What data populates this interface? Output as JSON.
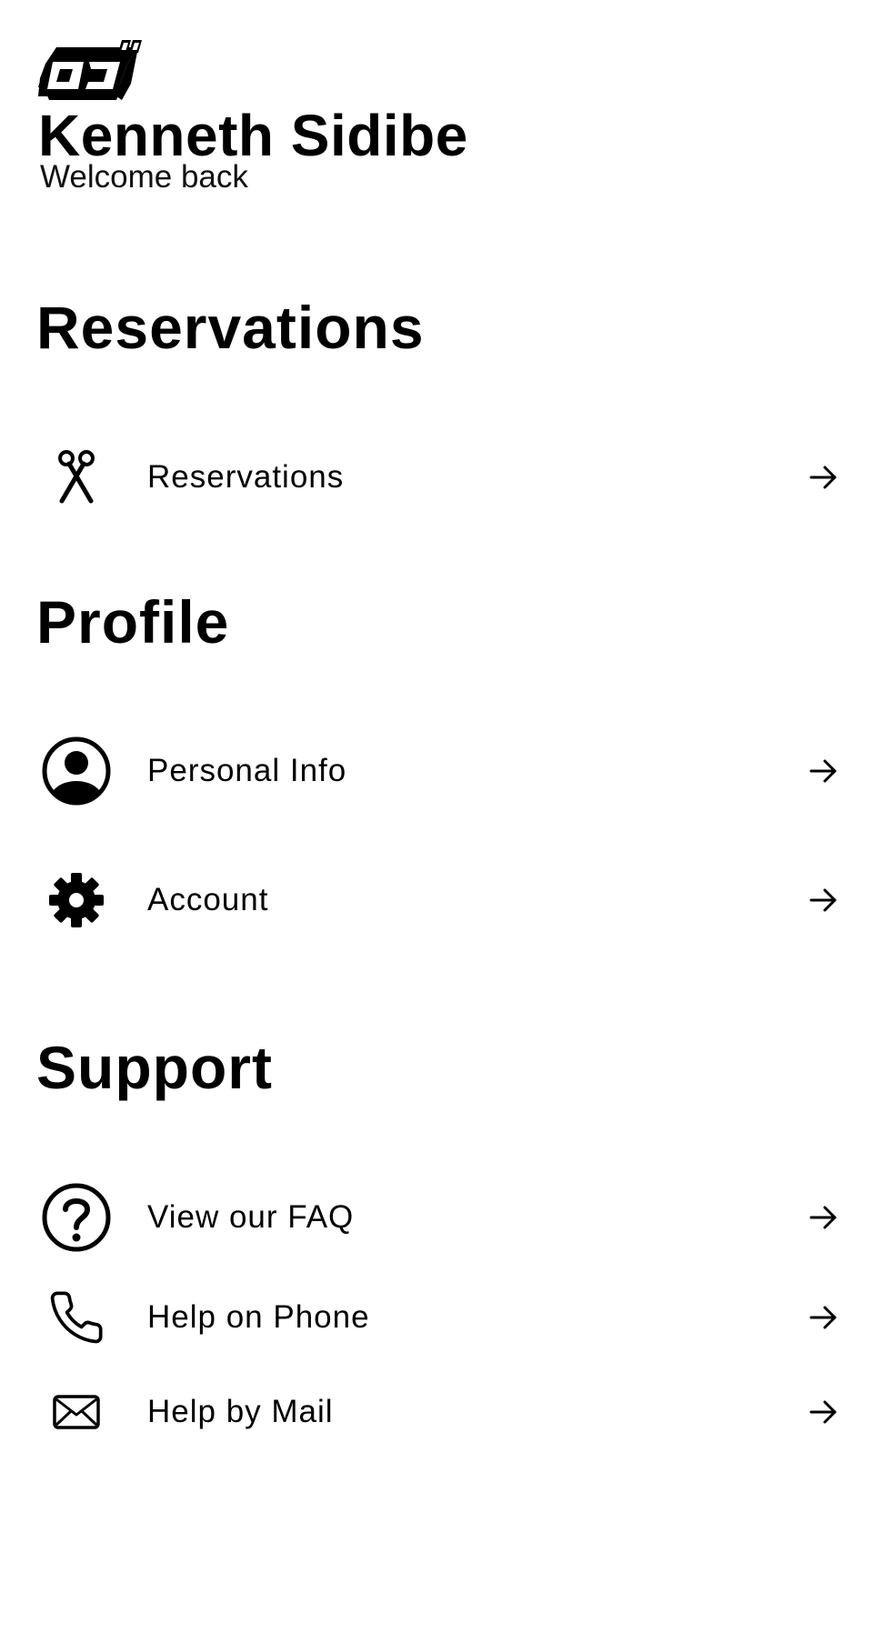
{
  "header": {
    "logo_text": "OJ",
    "user_name": "Kenneth Sidibe",
    "welcome_text": "Welcome back"
  },
  "sections": [
    {
      "title": "Reservations",
      "items": [
        {
          "label": "Reservations",
          "icon": "scissors-icon"
        }
      ]
    },
    {
      "title": "Profile",
      "items": [
        {
          "label": "Personal Info",
          "icon": "user-circle-icon"
        },
        {
          "label": "Account",
          "icon": "gear-icon"
        }
      ]
    },
    {
      "title": "Support",
      "items": [
        {
          "label": "View our FAQ",
          "icon": "question-circle-icon"
        },
        {
          "label": "Help on Phone",
          "icon": "phone-icon"
        },
        {
          "label": "Help by Mail",
          "icon": "mail-icon"
        }
      ]
    }
  ],
  "colors": {
    "background": "#ffffff",
    "foreground": "#000000"
  }
}
